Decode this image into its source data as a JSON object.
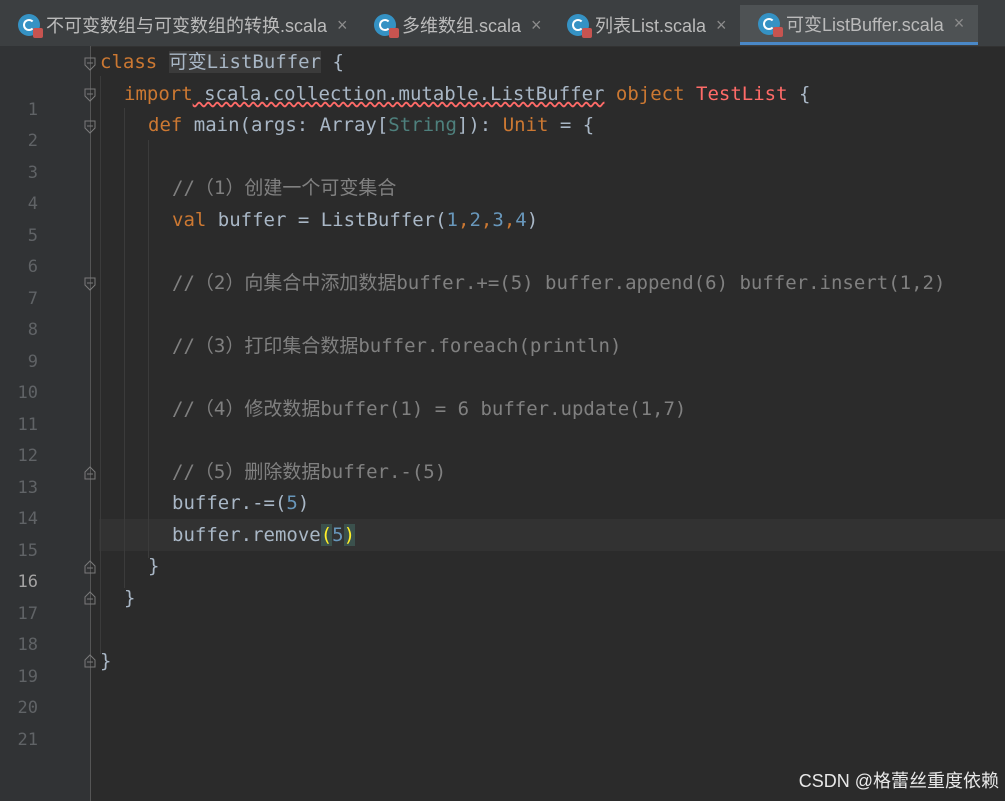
{
  "tabs": [
    {
      "label": "不可变数组与可变数组的转换.scala",
      "close": "×"
    },
    {
      "label": "多维数组.scala",
      "close": "×"
    },
    {
      "label": "列表List.scala",
      "close": "×"
    },
    {
      "label": "可变ListBuffer.scala",
      "close": "×",
      "active": true
    }
  ],
  "editor": {
    "line_numbers": [
      "1",
      "2",
      "3",
      "4",
      "5",
      "6",
      "7",
      "8",
      "9",
      "10",
      "11",
      "12",
      "13",
      "14",
      "15",
      "16",
      "17",
      "18",
      "19",
      "20",
      "21"
    ],
    "current_line": "16",
    "lines": {
      "l1": {
        "kw": "class",
        "name": "可变ListBuffer",
        "rest": " {"
      },
      "l2": {
        "kw": "import",
        "path": " scala.collection.mutable.ListBuffer",
        "kw2": "object",
        "obj": "TestList",
        "rest": " {"
      },
      "l3": {
        "kw": "def",
        "fn": "main",
        "p1": "(",
        "arg": "args",
        "p2": ": Array[",
        "tp": "String",
        "p3": "]): ",
        "unit": "Unit",
        "p4": " = {"
      },
      "l5": {
        "comment": "//（1）创建一个可变集合"
      },
      "l6": {
        "kw": "val",
        "pre": " buffer = ListBuffer(",
        "n1": "1",
        "n2": "2",
        "n3": "3",
        "n4": "4",
        "post": ")"
      },
      "l8": {
        "comment": "//（2）向集合中添加数据buffer.+=(5) buffer.append(6) buffer.insert(1,2)"
      },
      "l10": {
        "comment": "//（3）打印集合数据buffer.foreach(println)"
      },
      "l12": {
        "comment": "//（4）修改数据buffer(1) = 6 buffer.update(1,7)"
      },
      "l14": {
        "comment": "//（5）删除数据buffer.-(5)"
      },
      "l15": {
        "pre": "buffer.-=(",
        "n": "5",
        "post": ")"
      },
      "l16": {
        "pre": "buffer.remove",
        "open": "(",
        "n": "5",
        "close": ")"
      },
      "l17": {
        "text": "}"
      },
      "l18": {
        "text": "}"
      },
      "l20": {
        "text": "}"
      }
    }
  },
  "watermark": "CSDN @格蕾丝重度依赖",
  "colors": {
    "keyword": "#cc7832",
    "number": "#6897bb",
    "comment": "#808080",
    "background": "#2b2b2b",
    "tab_active_underline": "#4a88c7"
  }
}
